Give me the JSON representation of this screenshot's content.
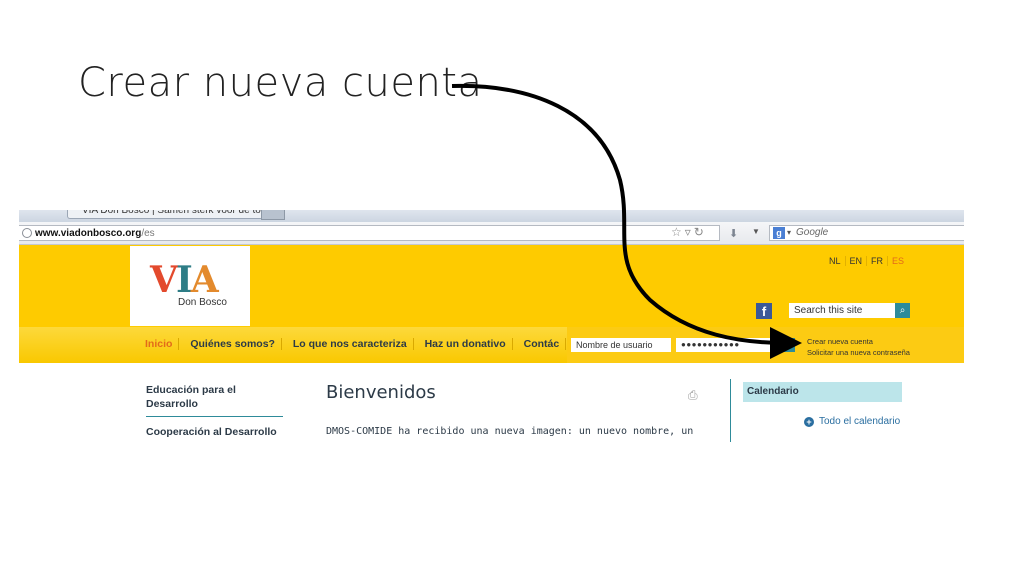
{
  "slide": {
    "title": "Crear nueva cuenta"
  },
  "browser": {
    "tab_title": "VIA Don Bosco | Samen sterk voor de toekomst",
    "url_host": "www.viadonbosco.org",
    "url_path": "/es",
    "search_engine_placeholder": "Google"
  },
  "site": {
    "logo_text": "VIA",
    "logo_subtitle": "Don Bosco",
    "languages": [
      "NL",
      "EN",
      "FR",
      "ES"
    ],
    "active_language": "ES",
    "search_placeholder": "Search this site",
    "nav": [
      "Inicio",
      "Quiénes somos?",
      "Lo que nos caracteriza",
      "Haz un donativo",
      "Contác"
    ],
    "login": {
      "username_placeholder": "Nombre de usuario",
      "password_mask": "●●●●●●●●●●●"
    },
    "account_links": {
      "create": "Crear nueva cuenta",
      "reset": "Solicitar una nueva contraseña"
    },
    "sidebar": [
      "Educación para el Desarrollo",
      "Cooperación al Desarrollo"
    ],
    "main": {
      "title": "Bienvenidos",
      "text": "DMOS-COMIDE ha recibido una nueva imagen: un nuevo nombre, un"
    },
    "calendar": {
      "heading": "Calendario",
      "link": "Todo el calendario"
    }
  },
  "colors": {
    "header_yellow": "#fecb00",
    "accent_teal": "#2e8b9a",
    "active_orange": "#e36a1a"
  }
}
